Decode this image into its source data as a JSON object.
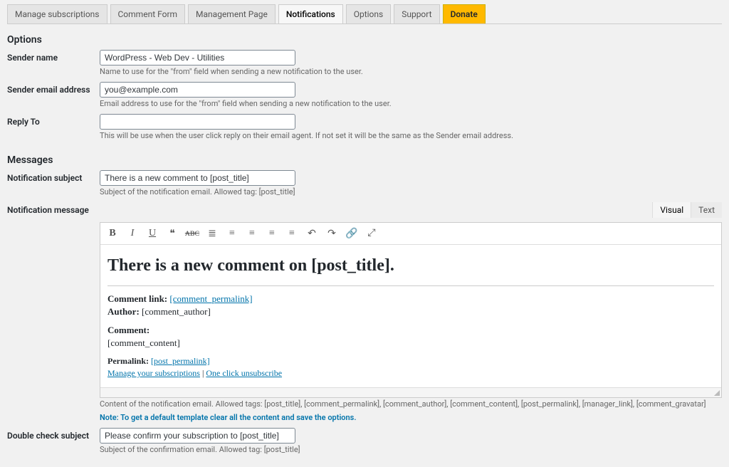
{
  "tabs": {
    "manage": "Manage subscriptions",
    "comment_form": "Comment Form",
    "management_page": "Management Page",
    "notifications": "Notifications",
    "options": "Options",
    "support": "Support",
    "donate": "Donate"
  },
  "sections": {
    "options": "Options",
    "messages": "Messages"
  },
  "fields": {
    "sender_name": {
      "label": "Sender name",
      "value": "WordPress - Web Dev - Utilities",
      "help": "Name to use for the \"from\" field when sending a new notification to the user."
    },
    "sender_email": {
      "label": "Sender email address",
      "value": "you@example.com",
      "help": "Email address to use for the \"from\" field when sending a new notification to the user."
    },
    "reply_to": {
      "label": "Reply To",
      "value": "",
      "help": "This will be use when the user click reply on their email agent. If not set it will be the same as the Sender email address."
    },
    "notification_subject": {
      "label": "Notification subject",
      "value": "There is a new comment to [post_title]",
      "help": "Subject of the notification email. Allowed tag: [post_title]"
    },
    "notification_message": {
      "label": "Notification message"
    },
    "double_check_subject": {
      "label": "Double check subject",
      "value": "Please confirm your subscription to [post_title]",
      "help": "Subject of the confirmation email. Allowed tag: [post_title]"
    }
  },
  "editor": {
    "tab_visual": "Visual",
    "tab_text": "Text",
    "heading": "There is a new comment on [post_title].",
    "comment_link_label": "Comment link:",
    "comment_link_value": "[comment_permalink]",
    "author_label": "Author:",
    "author_value": "[comment_author]",
    "comment_label": "Comment:",
    "comment_value": "[comment_content]",
    "permalink_label": "Permalink:",
    "permalink_value": "[post_permalink]",
    "manage_link": "Manage your subscriptions",
    "sep": " | ",
    "unsubscribe_link": "One click unsubscribe"
  },
  "editor_help": {
    "line1": "Content of the notification email. Allowed tags: [post_title], [comment_permalink], [comment_author], [comment_content], [post_permalink], [manager_link], [comment_gravatar]",
    "line2": "Note: To get a default template clear all the content and save the options."
  }
}
